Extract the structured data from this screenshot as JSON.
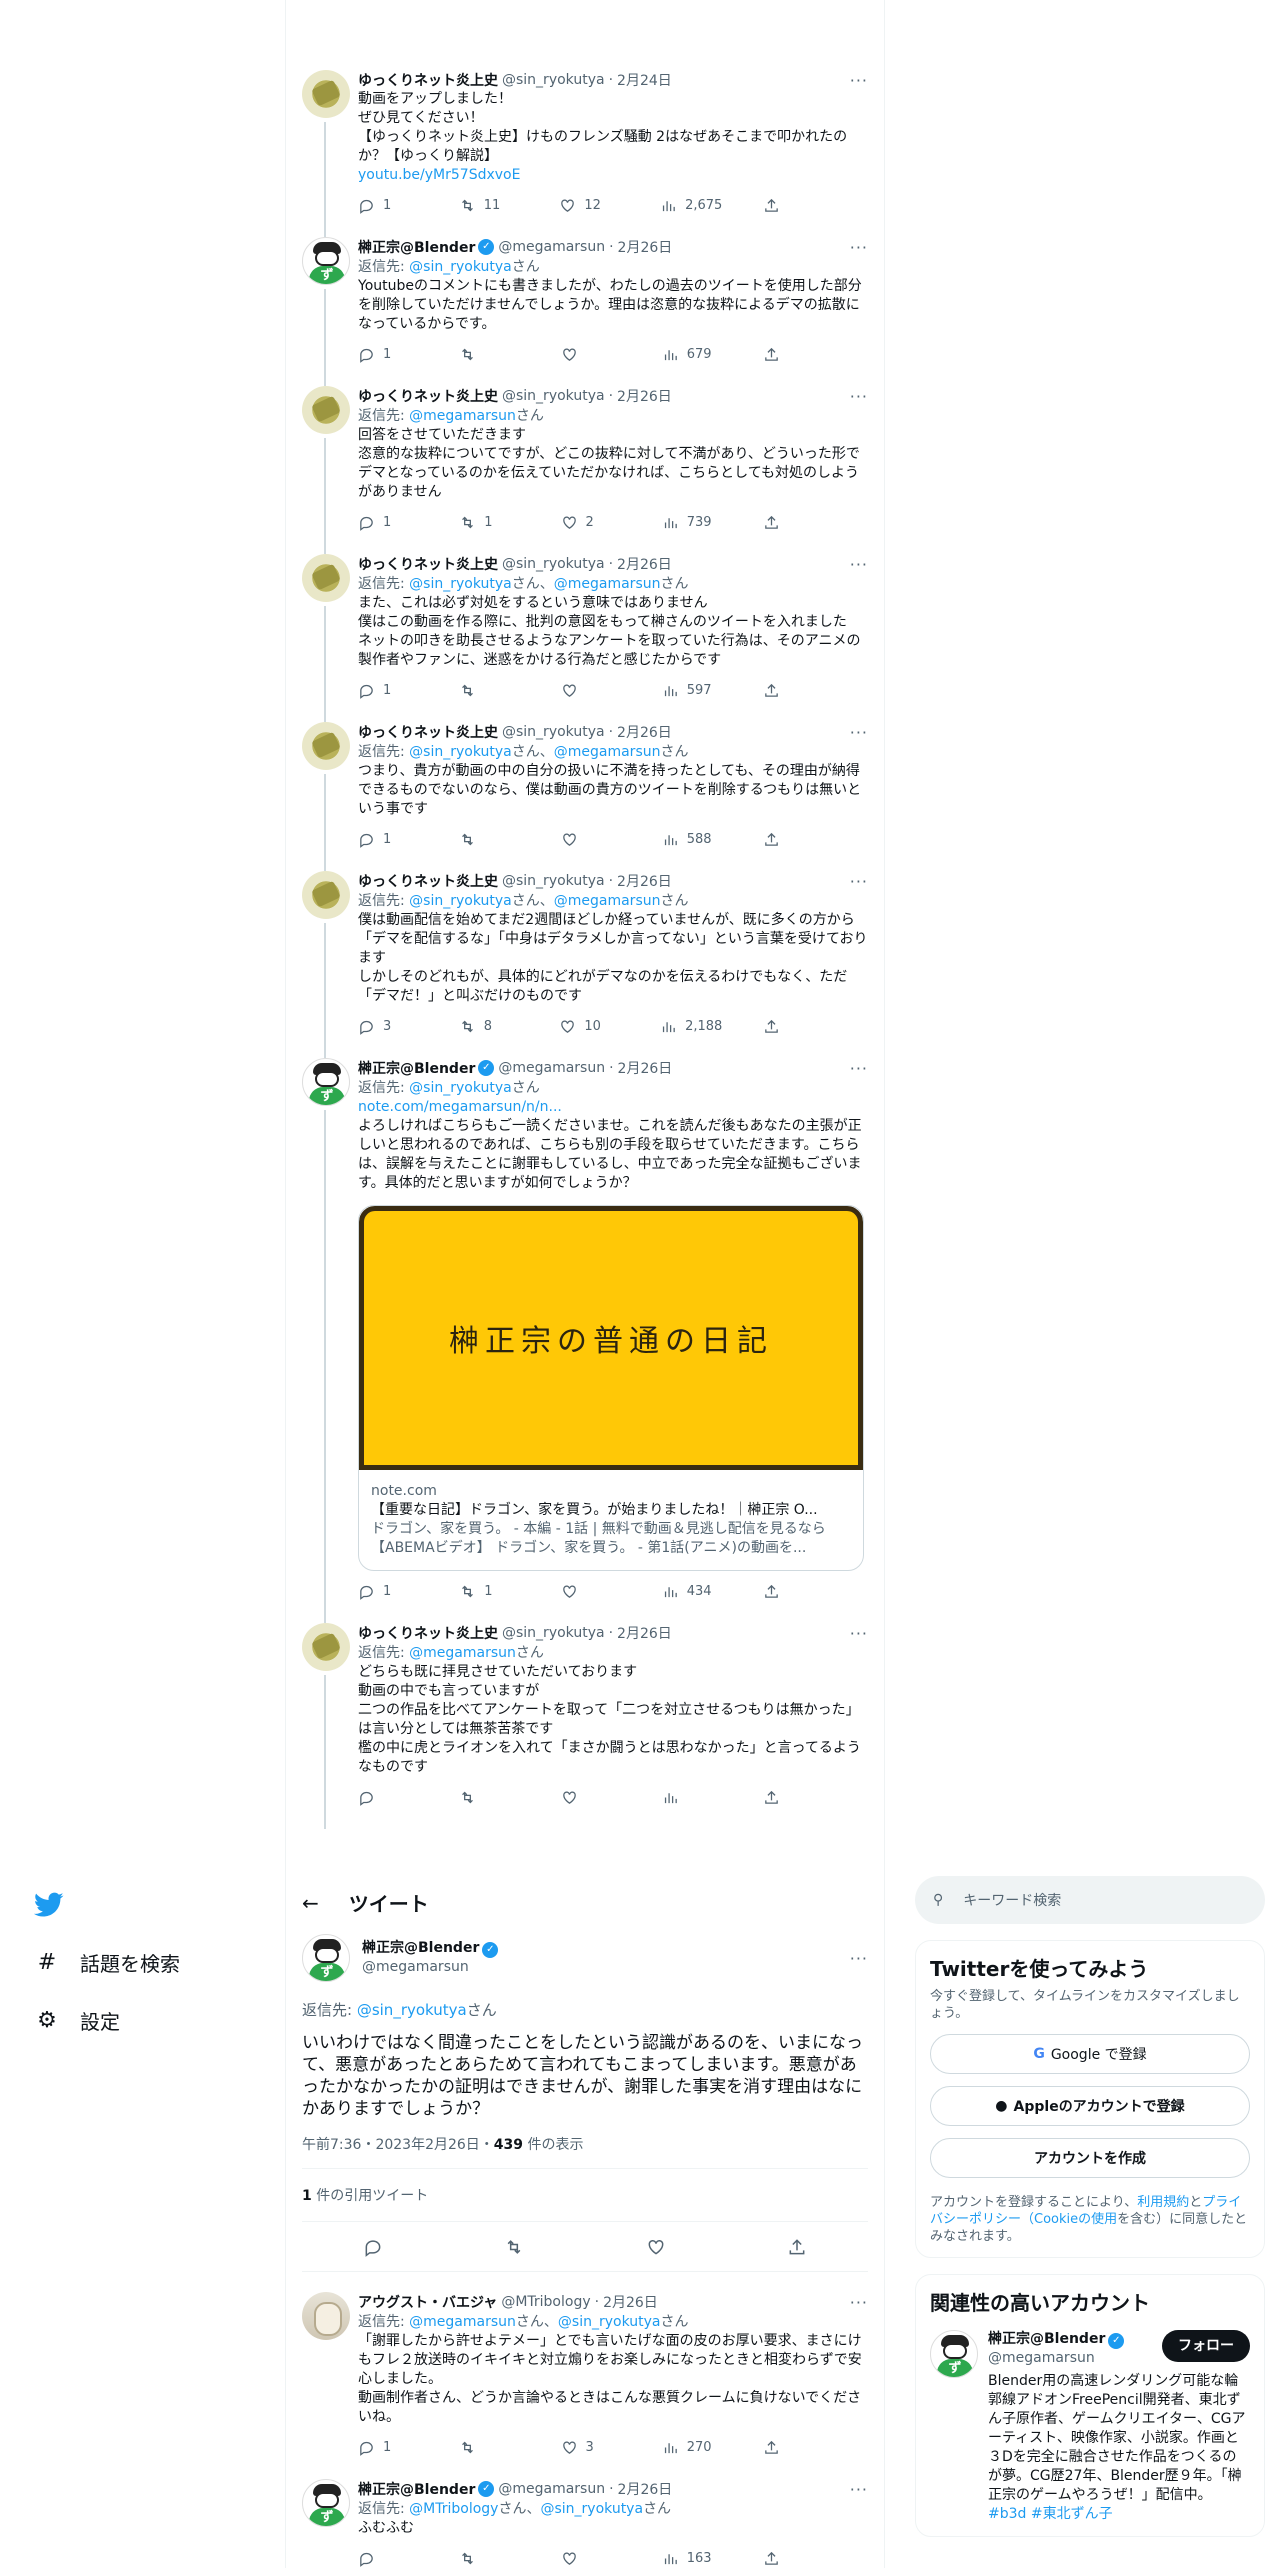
{
  "thread": [
    {
      "avatar": "yukkuri",
      "name": "ゆっくりネット炎上史",
      "verified": false,
      "handle": "@sin_ryokutya",
      "date": "2月24日",
      "reply_prefix": "",
      "reply_to": [],
      "text": "動画をアップしました！\nぜひ見てください！\n【ゆっくりネット炎上史】けものフレンズ騒動 2はなぜあそこまで叩かれたのか？【ゆっくり解説】",
      "link": "youtu.be/yMr57SdxvoE",
      "reply": "1",
      "retweet": "11",
      "like": "12",
      "views": "2,675",
      "line": true
    },
    {
      "avatar": "sakaki",
      "name": "榊正宗@Blender",
      "verified": true,
      "handle": "@megamarsun",
      "date": "2月26日",
      "reply_prefix": "返信先: ",
      "reply_to": [
        "@sin_ryokutya"
      ],
      "reply_suffix": "さん",
      "text": "Youtubeのコメントにも書きましたが、わたしの過去のツイートを使用した部分を削除していただけませんでしょうか。理由は恣意的な抜粋によるデマの拡散になっているからです。",
      "link": "",
      "reply": "1",
      "retweet": "",
      "like": "",
      "views": "679",
      "line": true
    },
    {
      "avatar": "yukkuri",
      "name": "ゆっくりネット炎上史",
      "verified": false,
      "handle": "@sin_ryokutya",
      "date": "2月26日",
      "reply_prefix": "返信先: ",
      "reply_to": [
        "@megamarsun"
      ],
      "reply_suffix": "さん",
      "text": "回答をさせていただきます\n恣意的な抜粋についてですが、どこの抜粋に対して不満があり、どういった形でデマとなっているのかを伝えていただかなければ、こちらとしても対処のしようがありません",
      "link": "",
      "reply": "1",
      "retweet": "1",
      "like": "2",
      "views": "739",
      "line": true
    },
    {
      "avatar": "yukkuri",
      "name": "ゆっくりネット炎上史",
      "verified": false,
      "handle": "@sin_ryokutya",
      "date": "2月26日",
      "reply_prefix": "返信先: ",
      "reply_to": [
        "@sin_ryokutya",
        "@megamarsun"
      ],
      "reply_suffix": "さん",
      "text": "また、これは必ず対処をするという意味ではありません\n僕はこの動画を作る際に、批判の意図をもって榊さんのツイートを入れました\nネットの叩きを助長させるようなアンケートを取っていた行為は、そのアニメの製作者やファンに、迷惑をかける行為だと感じたからです",
      "link": "",
      "reply": "1",
      "retweet": "",
      "like": "",
      "views": "597",
      "line": true
    },
    {
      "avatar": "yukkuri",
      "name": "ゆっくりネット炎上史",
      "verified": false,
      "handle": "@sin_ryokutya",
      "date": "2月26日",
      "reply_prefix": "返信先: ",
      "reply_to": [
        "@sin_ryokutya",
        "@megamarsun"
      ],
      "reply_suffix": "さん",
      "text": "つまり、貴方が動画の中の自分の扱いに不満を持ったとしても、その理由が納得できるものでないのなら、僕は動画の貴方のツイートを削除するつもりは無いという事です",
      "link": "",
      "reply": "1",
      "retweet": "",
      "like": "",
      "views": "588",
      "line": true
    },
    {
      "avatar": "yukkuri",
      "name": "ゆっくりネット炎上史",
      "verified": false,
      "handle": "@sin_ryokutya",
      "date": "2月26日",
      "reply_prefix": "返信先: ",
      "reply_to": [
        "@sin_ryokutya",
        "@megamarsun"
      ],
      "reply_suffix": "さん",
      "text": "僕は動画配信を始めてまだ2週間ほどしか経っていませんが、既に多くの方から「デマを配信するな」「中身はデタラメしか言ってない」という言葉を受けております\nしかしそのどれもが、具体的にどれがデマなのかを伝えるわけでもなく、ただ「デマだ！」と叫ぶだけのものです",
      "link": "",
      "reply": "3",
      "retweet": "8",
      "like": "10",
      "views": "2,188",
      "line": true
    },
    {
      "avatar": "sakaki",
      "name": "榊正宗@Blender",
      "verified": true,
      "handle": "@megamarsun",
      "date": "2月26日",
      "reply_prefix": "返信先: ",
      "reply_to": [
        "@sin_ryokutya"
      ],
      "reply_suffix": "さん",
      "text": "",
      "link": "note.com/megamarsun/n/n...",
      "text_after": "よろしければこちらもご一読くださいませ。これを読んだ後もあなたの主張が正しいと思われるのであれば、こちらも別の手段を取らせていただきます。こちらは、誤解を与えたことに謝罪もしているし、中立であった完全な証拠もございます。具体的だと思いますが如何でしょうか？",
      "card": {
        "image_text": "榊正宗の普通の日記",
        "domain": "note.com",
        "title": "【重要な日記】ドラゴン、家を買う。が始まりましたね！｜榊正宗 O...",
        "desc": "ドラゴン、家を買う。 - 本編 - 1話 | 無料で動画＆見逃し配信を見るなら【ABEMAビデオ】 ドラゴン、家を買う。 - 第1話(アニメ)の動画を..."
      },
      "reply": "1",
      "retweet": "1",
      "like": "",
      "views": "434",
      "line": true
    },
    {
      "avatar": "yukkuri",
      "name": "ゆっくりネット炎上史",
      "verified": false,
      "handle": "@sin_ryokutya",
      "date": "2月26日",
      "reply_prefix": "返信先: ",
      "reply_to": [
        "@megamarsun"
      ],
      "reply_suffix": "さん",
      "text": "どちらも既に拝見させていただいております\n動画の中でも言っていますが\n二つの作品を比べてアンケートを取って「二つを対立させるつもりは無かった」は言い分としては無茶苦茶です\n檻の中に虎とライオンを入れて「まさか闘うとは思わなかった」と言ってるようなものです",
      "link": "",
      "reply": "",
      "retweet": "",
      "like": "",
      "views": "",
      "line": true
    }
  ],
  "nav": {
    "explore": "話題を検索",
    "settings": "設定"
  },
  "detail": {
    "header": "ツイート",
    "name": "榊正宗@Blender",
    "handle": "@megamarsun",
    "reply_prefix": "返信先: ",
    "reply_to": "@sin_ryokutya",
    "reply_suffix": "さん",
    "text": "いいわけではなく間違ったことをしたという認識があるのを、いまになって、悪意があったとあらためて言われてもこまってしまいます。悪意があったかなかったかの証明はできませんが、謝罪した事実を消す理由はなにかありますでしょうか？",
    "time": "午前7:36・2023年2月26日・",
    "views_count": "439",
    "views_label": " 件の表示",
    "quote_count": "1",
    "quote_label": " 件の引用ツイート"
  },
  "replies": [
    {
      "avatar": "august",
      "name": "アウグスト・バエジャ",
      "verified": false,
      "handle": "@MTribology",
      "date": "2月26日",
      "reply_prefix": "返信先: ",
      "reply_to": [
        "@megamarsun",
        "@sin_ryokutya"
      ],
      "reply_suffix": "さん",
      "text": "「謝罪したから許せよテメー」とでも言いたげな面の皮のお厚い要求、まさにけもフレ２放送時のイキイキと対立煽りをお楽しみになったときと相変わらずで安心しました。\n動画制作者さん、どうか言論やるときはこんな悪質クレームに負けないでくださいね。",
      "reply": "1",
      "retweet": "",
      "like": "3",
      "views": "270"
    },
    {
      "avatar": "sakaki",
      "name": "榊正宗@Blender",
      "verified": true,
      "handle": "@megamarsun",
      "date": "2月26日",
      "reply_prefix": "返信先: ",
      "reply_to": [
        "@MTribology",
        "@sin_ryokutya"
      ],
      "reply_suffix": "さん",
      "text": "ふむふむ",
      "reply": "",
      "retweet": "",
      "like": "",
      "views": "163"
    }
  ],
  "sidebar": {
    "search_placeholder": "キーワード検索",
    "signup_title": "Twitterを使ってみよう",
    "signup_sub": "今すぐ登録して、タイムラインをカスタマイズしましょう。",
    "google_btn": "Google で登録",
    "apple_btn": "Appleのアカウントで登録",
    "create_btn": "アカウントを作成",
    "legal_1": "アカウントを登録することにより、",
    "legal_terms": "利用規約",
    "legal_2": "と",
    "legal_privacy": "プライバシーポリシー",
    "legal_cookie": "（Cookieの使用",
    "legal_3": "を含む）に同意したとみなされます。",
    "related_title": "関連性の高いアカウント",
    "rel_name": "榊正宗@Blender",
    "rel_handle": "@megamarsun",
    "follow": "フォロー",
    "rel_bio": "Blender用の高速レンダリング可能な輪郭線アドオンFreePencil開発者、東北ずん子原作者、ゲームクリエイター、CGアーティスト、映像作家、小説家。作画と３Dを完全に融合させた作品をつくるのが夢。CG歴27年、Blender歴９年。「榊正宗のゲームやろうぜ！」配信中。",
    "rel_tags": "#b3d #東北ずん子"
  },
  "colors": {
    "accent": "#1d9bf0",
    "text": "#0f1419",
    "muted": "#536471",
    "border": "#eff3f4"
  }
}
